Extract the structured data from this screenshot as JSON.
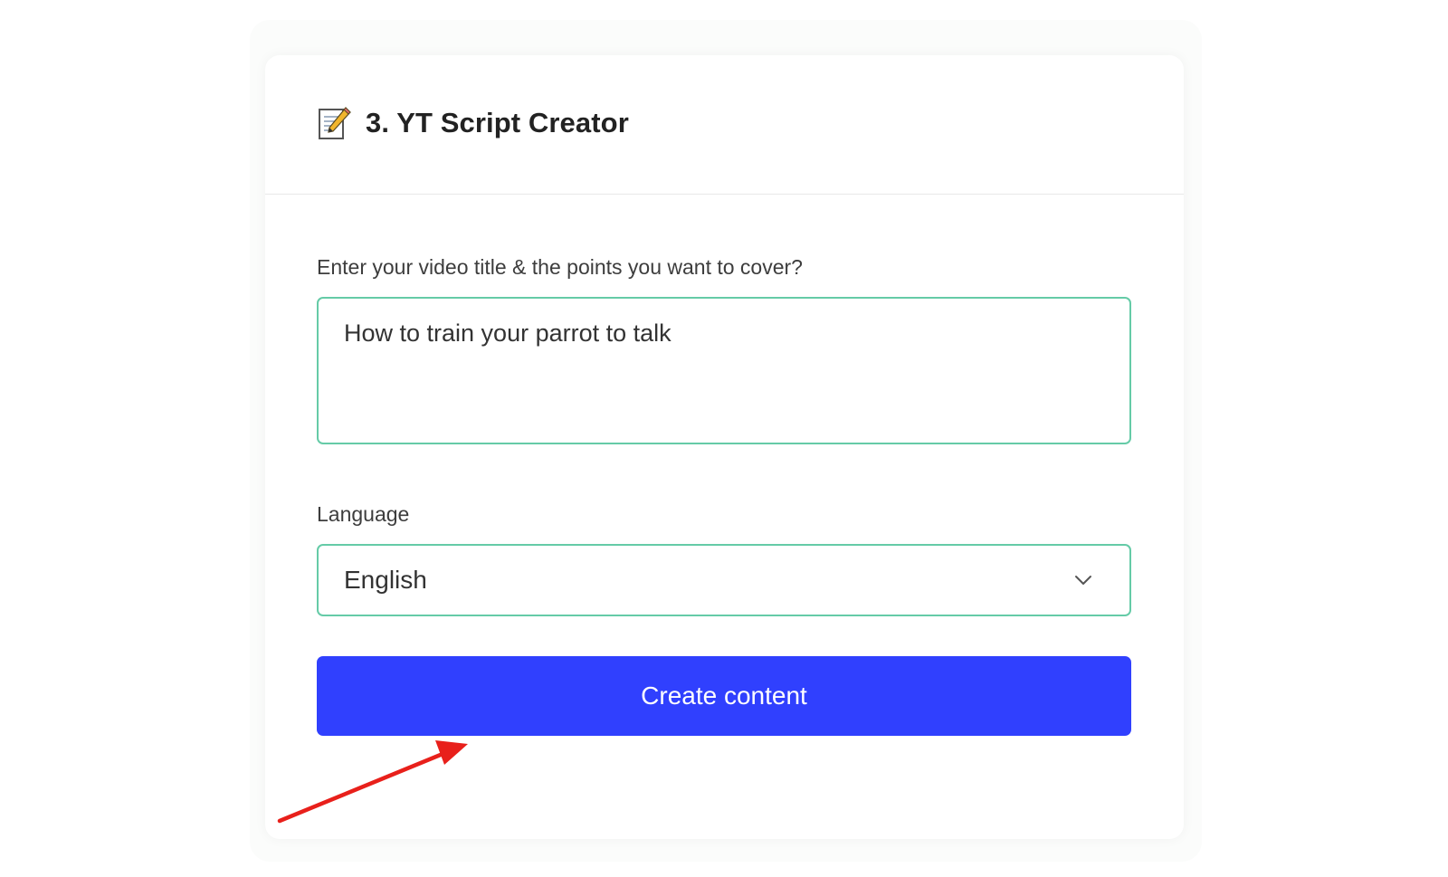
{
  "card": {
    "title": "3. YT Script Creator",
    "title_icon": "memo-pencil-icon"
  },
  "form": {
    "prompt_label": "Enter your video title & the points you want to cover?",
    "prompt_value": "How to train your parrot to talk",
    "language_label": "Language",
    "language_value": "English",
    "submit_label": "Create content"
  },
  "colors": {
    "accent_border": "#65cba7",
    "button_bg": "#3040fe",
    "arrow": "#e8201b"
  }
}
